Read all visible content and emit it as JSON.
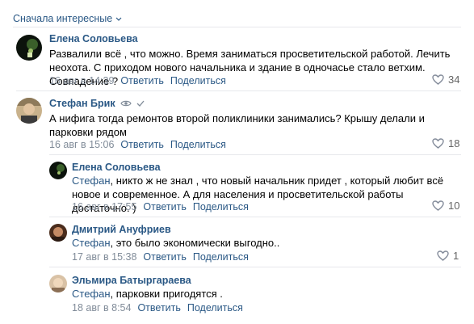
{
  "sort": {
    "label": "Сначала интересные"
  },
  "comments": [
    {
      "author": "Елена Соловьева",
      "text": "Развалили всё , что можно. Время заниматься просветительской работой. Лечить неохота. С приходом нового начальника и здание в одночасье стало ветхим. Совпадение ?",
      "time": "16 авг в 14:39",
      "reply_label": "Ответить",
      "share_label": "Поделиться",
      "likes": "34"
    },
    {
      "author": "Стефан Брик",
      "text": "А нифига тогда ремонтов второй поликлиники занимались? Крышу делали и парковки рядом",
      "time": "16 авг в 15:06",
      "reply_label": "Ответить",
      "share_label": "Поделиться",
      "likes": "18"
    },
    {
      "author": "Елена Соловьева",
      "mention": "Стефан",
      "text": ", никто ж не знал , что новый начальник придет , который любит всё новое и современное. А для населения и просветительской работы достаточно. )",
      "time": "16 авг в 17:55",
      "reply_label": "Ответить",
      "share_label": "Поделиться",
      "likes": "10"
    },
    {
      "author": "Дмитрий Ануфриев",
      "mention": "Стефан",
      "text": ", это было экономически выгодно..",
      "time": "17 авг в 15:38",
      "reply_label": "Ответить",
      "share_label": "Поделиться",
      "likes": "1"
    },
    {
      "author": "Эльмира Батыргараева",
      "mention": "Стефан",
      "text": ", парковки пригодятся .",
      "time": "18 авг в 8:54",
      "reply_label": "Ответить",
      "share_label": "Поделиться",
      "likes": ""
    }
  ],
  "colors": {
    "link": "#2a5885",
    "meta": "#818c99",
    "divider": "#e7e8ec"
  }
}
